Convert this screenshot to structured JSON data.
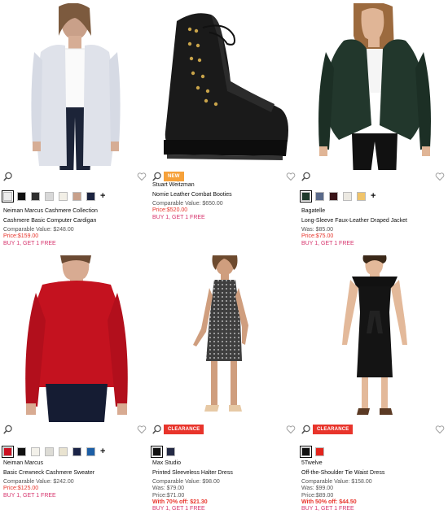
{
  "colors": {
    "price_red": "#e8342b",
    "promo_pink": "#d6336c",
    "badge_new": "#f6a13a",
    "badge_clearance": "#e8342b"
  },
  "icons": {
    "quick_view": "magnifier-icon",
    "favorite": "heart-icon",
    "more_colors": "plus-icon"
  },
  "products": [
    {
      "designer": "Neiman Marcus Cashmere Collection",
      "name": "Cashmere Basic Computer Cardigan",
      "comparable": "Comparable Value: $248.00",
      "price": "Price:$159.00",
      "promo": "BUY 1, GET 1 FREE",
      "swatches": [
        "#ececec",
        "#111111",
        "#2f2f2f",
        "#d8d8d8",
        "#f2efe6",
        "#c8a08a",
        "#1c2440"
      ],
      "more_colors": "+"
    },
    {
      "badge": "NEW",
      "designer": "Stuart Weitzman",
      "name": "Nomie Leather Combat Booties",
      "comparable": "Comparable Value: $650.00",
      "price": "Price:$520.00",
      "promo": "BUY 1, GET 1 FREE"
    },
    {
      "designer": "Bagatelle",
      "name": "Long-Sleeve Faux-Leather Draped Jacket",
      "was": "Was: $85.00",
      "price": "Price:$75.00",
      "promo": "BUY 1, GET 1 FREE",
      "swatches": [
        "#1f3a2c",
        "#5a6a8a",
        "#3a1418",
        "#ece9e2",
        "#f0c46a"
      ],
      "more_colors": "+"
    },
    {
      "designer": "Neiman Marcus",
      "name": "Basic Crewneck Cashmere Sweater",
      "comparable": "Comparable Value: $242.00",
      "price": "Price:$125.00",
      "promo": "BUY 1, GET 1 FREE",
      "swatches": [
        "#cc1021",
        "#111111",
        "#f3f1ea",
        "#dddcd6",
        "#e9e3d0",
        "#1b2447",
        "#1d5fa6"
      ],
      "more_colors": "+"
    },
    {
      "badge": "CLEARANCE",
      "designer": "Max Studio",
      "name": "Printed Sleeveless Halter Dress",
      "comparable": "Comparable Value: $98.00",
      "was": "Was: $79.00",
      "price": "Price:$71.00",
      "discount": "With 70% off: $21.30",
      "promo": "BUY 1, GET 1 FREE",
      "swatches": [
        "#111111",
        "#242a45"
      ]
    },
    {
      "badge": "CLEARANCE",
      "designer": "5Twelve",
      "name": "Off-the-Shoulder Tie Waist Dress",
      "comparable": "Comparable Value: $158.00",
      "was": "Was: $99.00",
      "price": "Price:$89.00",
      "discount": "With 50% off: $44.50",
      "promo": "BUY 1, GET 1 FREE",
      "swatches": [
        "#111111",
        "#e3241c"
      ]
    }
  ]
}
